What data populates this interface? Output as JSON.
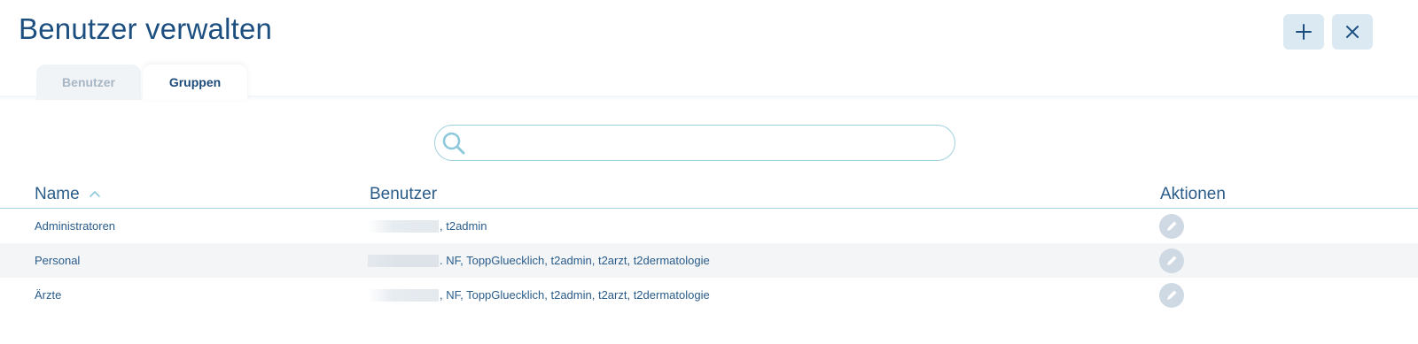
{
  "page": {
    "title": "Benutzer verwalten"
  },
  "header": {
    "add_icon": "plus-icon",
    "close_icon": "close-icon"
  },
  "tabs": [
    {
      "label": "Benutzer",
      "active": false
    },
    {
      "label": "Gruppen",
      "active": true
    }
  ],
  "search": {
    "value": "",
    "placeholder": ""
  },
  "table": {
    "columns": [
      "Name",
      "Benutzer",
      "Aktionen"
    ],
    "sort": {
      "column": "Name",
      "direction": "ascending"
    },
    "rows": [
      {
        "name": "Administratoren",
        "users": ", t2admin"
      },
      {
        "name": "Personal",
        "users": ". NF, ToppGluecklich, t2admin, t2arzt, t2dermatologie"
      },
      {
        "name": "Ärzte",
        "users": ", NF, ToppGluecklich, t2admin, t2arzt, t2dermatologie"
      }
    ]
  },
  "colors": {
    "accent": "#1c4f80",
    "button_bg": "#dbe9f3",
    "border": "#a7d3e2",
    "row_alt": "#f3f5f7"
  }
}
